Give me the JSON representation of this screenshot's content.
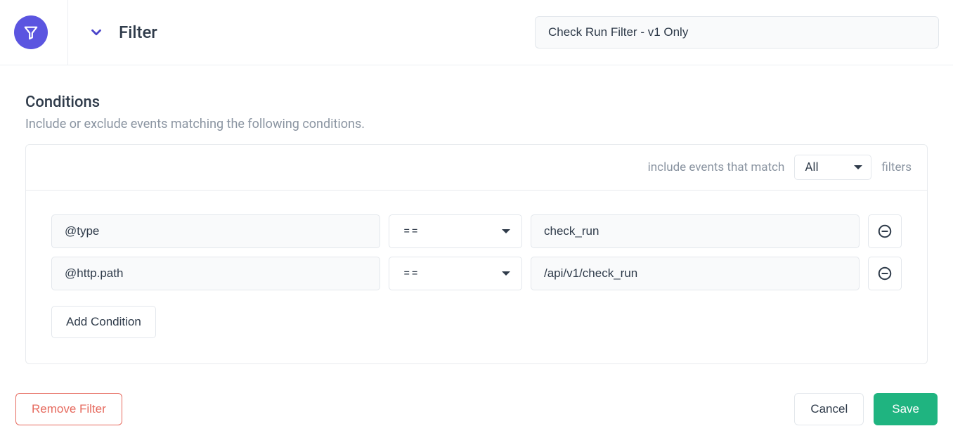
{
  "header": {
    "title": "Filter",
    "filter_name": "Check Run Filter - v1 Only"
  },
  "conditions": {
    "title": "Conditions",
    "subtitle": "Include or exclude events matching the following conditions.",
    "include_text_before": "include events that match",
    "include_text_after": "filters",
    "match_mode": "All",
    "rows": [
      {
        "attribute": "@type",
        "operator": "==",
        "value": "check_run"
      },
      {
        "attribute": "@http.path",
        "operator": "==",
        "value": "/api/v1/check_run"
      }
    ],
    "add_condition_label": "Add Condition"
  },
  "footer": {
    "remove_label": "Remove Filter",
    "cancel_label": "Cancel",
    "save_label": "Save"
  }
}
